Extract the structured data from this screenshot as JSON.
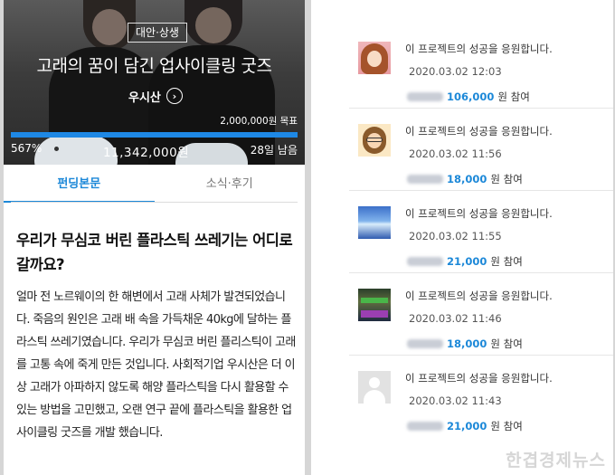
{
  "hero": {
    "category_badge": "대안·상생",
    "title": "고래의 꿈이 담긴 업사이클링 굿즈",
    "creator": "우시산",
    "goal": "2,000,000원 목표",
    "progress_percent": 100,
    "percent": "567%",
    "amount": "11,342,000원",
    "days_left": "28일 남음"
  },
  "tabs": [
    {
      "label": "펀딩본문",
      "active": true
    },
    {
      "label": "소식·후기",
      "active": false
    }
  ],
  "article": {
    "title": "우리가 무심코 버린 플라스틱 쓰레기는 어디로 갈까요?",
    "body": "얼마 전 노르웨이의 한 해변에서 고래 사체가 발견되었습니다. 죽음의 원인은 고래 배 속을 가득채운 40kg에 달하는 플라스틱 쓰레기였습니다. 우리가 무심코 버린 플리스틱이 고래를 고통 속에 죽게 만든 것입니다. 사회적기업 우시산은 더 이상 고래가 아파하지 않도록 해양 플라스틱을 다시 활용할 수 있는 방법을 고민했고, 오랜 연구 끝에 플라스틱을 활용한 업사이클링 굿즈를 개발 했습니다."
  },
  "supporters": [
    {
      "message": "이 프로젝트의 성공을 응원합니다.",
      "date": "2020.03.02 12:03",
      "amount": "106,000",
      "unit": "원 참여",
      "avatar": "cartoon-girl-avatar"
    },
    {
      "message": "이 프로젝트의 성공을 응원합니다.",
      "date": "2020.03.02 11:56",
      "amount": "18,000",
      "unit": "원 참여",
      "avatar": "cartoon-glasses-avatar"
    },
    {
      "message": "이 프로젝트의 성공을 응원합니다.",
      "date": "2020.03.02 11:55",
      "amount": "21,000",
      "unit": "원 참여",
      "avatar": "sky-photo-avatar"
    },
    {
      "message": "이 프로젝트의 성공을 응원합니다.",
      "date": "2020.03.02 11:46",
      "amount": "18,000",
      "unit": "원 참여",
      "avatar": "neon-photo-avatar"
    },
    {
      "message": "이 프로젝트의 성공을 응원합니다.",
      "date": "2020.03.02 11:43",
      "amount": "21,000",
      "unit": "원 참여",
      "avatar": "default-user-avatar"
    }
  ],
  "watermark": "한겹경제뉴스",
  "colors": {
    "accent": "#1c88d8",
    "progress": "#1e88e5"
  }
}
